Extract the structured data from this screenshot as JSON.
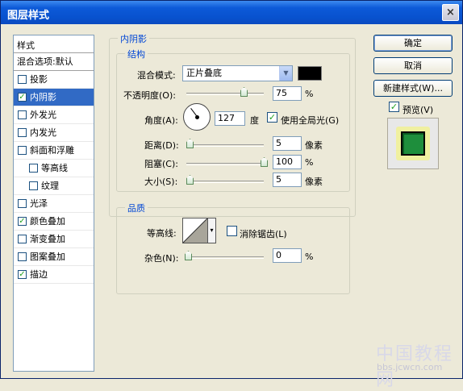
{
  "window": {
    "title": "图层样式",
    "close_glyph": "×"
  },
  "sidebar": {
    "header": "样式",
    "blend_default": "混合选项:默认",
    "items": [
      {
        "label": "投影",
        "checked": false,
        "sub": false,
        "selected": false
      },
      {
        "label": "内阴影",
        "checked": true,
        "sub": false,
        "selected": true
      },
      {
        "label": "外发光",
        "checked": false,
        "sub": false,
        "selected": false
      },
      {
        "label": "内发光",
        "checked": false,
        "sub": false,
        "selected": false
      },
      {
        "label": "斜面和浮雕",
        "checked": false,
        "sub": false,
        "selected": false
      },
      {
        "label": "等高线",
        "checked": false,
        "sub": true,
        "selected": false
      },
      {
        "label": "纹理",
        "checked": false,
        "sub": true,
        "selected": false
      },
      {
        "label": "光泽",
        "checked": false,
        "sub": false,
        "selected": false
      },
      {
        "label": "颜色叠加",
        "checked": true,
        "sub": false,
        "selected": false
      },
      {
        "label": "渐变叠加",
        "checked": false,
        "sub": false,
        "selected": false
      },
      {
        "label": "图案叠加",
        "checked": false,
        "sub": false,
        "selected": false
      },
      {
        "label": "描边",
        "checked": true,
        "sub": false,
        "selected": false
      }
    ]
  },
  "inner_shadow": {
    "group_title": "内阴影",
    "structure_title": "结构",
    "blend_mode_label": "混合模式:",
    "blend_mode_value": "正片叠底",
    "shadow_color": "#000000",
    "opacity_label": "不透明度(O):",
    "opacity_value": "75",
    "opacity_unit": "%",
    "angle_label": "角度(A):",
    "angle_value": "127",
    "angle_unit": "度",
    "global_light_label": "使用全局光(G)",
    "global_light_checked": true,
    "distance_label": "距离(D):",
    "distance_value": "5",
    "distance_unit": "像素",
    "choke_label": "阻塞(C):",
    "choke_value": "100",
    "choke_unit": "%",
    "size_label": "大小(S):",
    "size_value": "5",
    "size_unit": "像素"
  },
  "quality": {
    "title": "品质",
    "contour_label": "等高线:",
    "antialias_label": "消除锯齿(L)",
    "antialias_checked": false,
    "noise_label": "杂色(N):",
    "noise_value": "0",
    "noise_unit": "%"
  },
  "buttons": {
    "ok": "确定",
    "cancel": "取消",
    "new_style": "新建样式(W)...",
    "preview_label": "预览(V)",
    "preview_checked": true
  },
  "watermark": {
    "line1": "中国教程网",
    "line2": "bbs.jcwcn.com"
  }
}
